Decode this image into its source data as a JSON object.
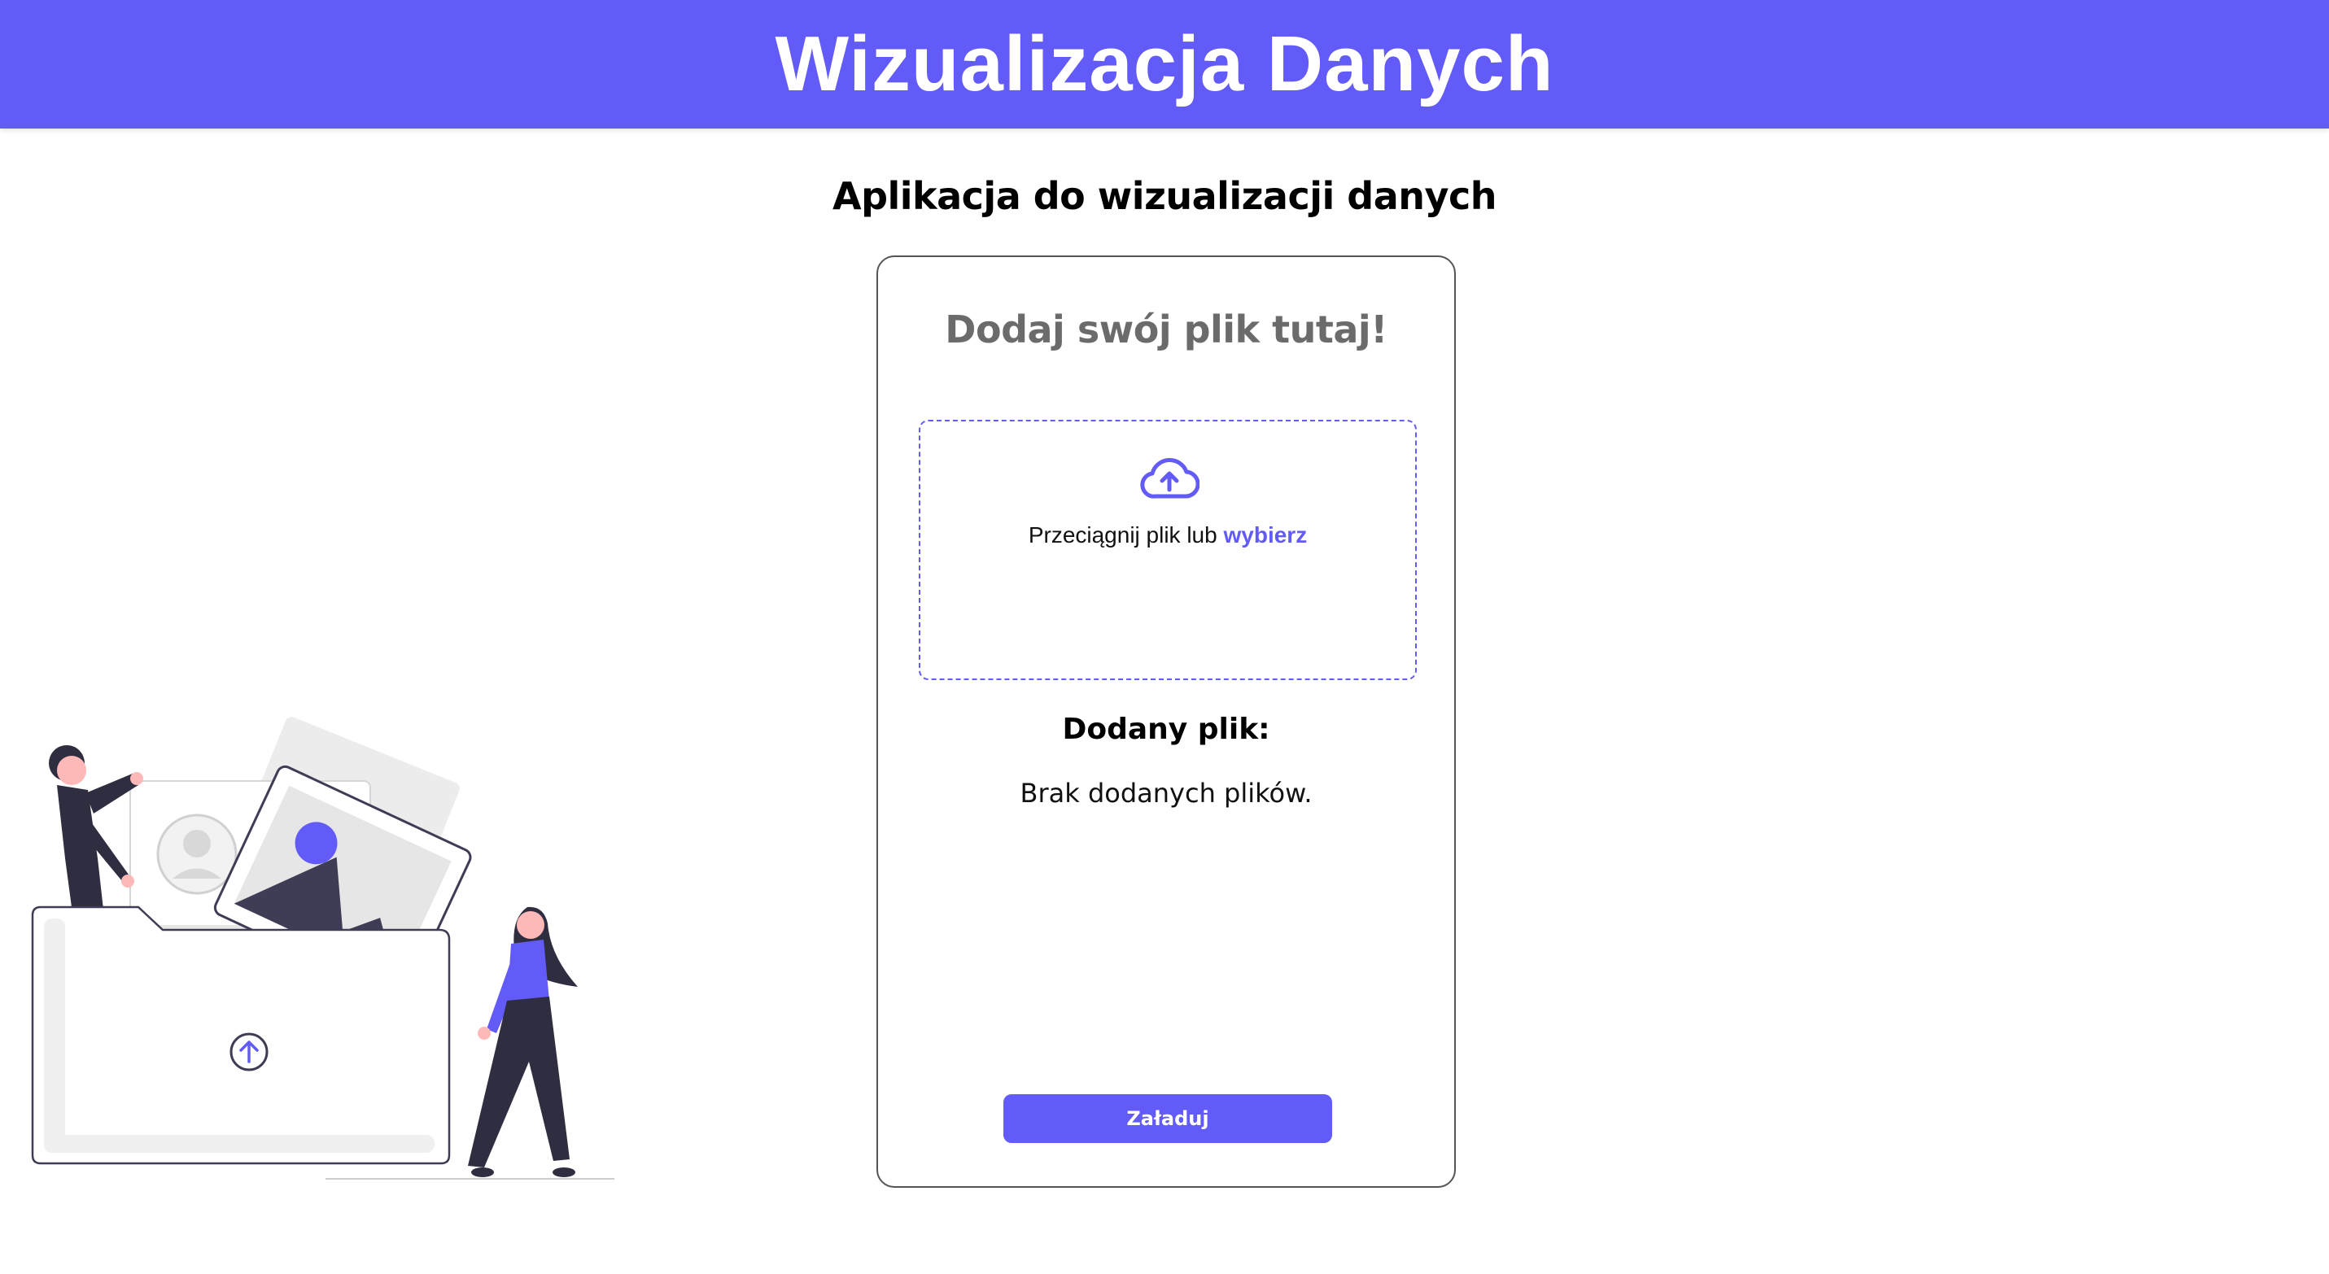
{
  "header": {
    "title": "Wizualizacja Danych"
  },
  "main": {
    "subtitle": "Aplikacja do wizualizacji danych"
  },
  "card": {
    "title": "Dodaj swój plik tutaj!",
    "dropzone": {
      "text": "Przeciągnij plik lub ",
      "link": "wybierz",
      "icon": "cloud-upload-icon"
    },
    "added_title": "Dodany plik:",
    "no_files": "Brak dodanych plików.",
    "upload_button": "Załaduj"
  },
  "colors": {
    "accent": "#635bf7",
    "dark": "#2f2e41",
    "white": "#ffffff"
  }
}
